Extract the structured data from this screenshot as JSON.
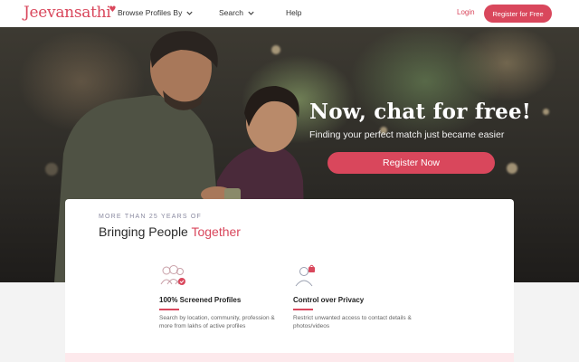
{
  "header": {
    "logo": "Jeevansathi",
    "nav": [
      {
        "label": "Browse Profiles By",
        "has_dropdown": true
      },
      {
        "label": "Search",
        "has_dropdown": true
      },
      {
        "label": "Help",
        "has_dropdown": false
      }
    ],
    "login_label": "Login",
    "register_label": "Register for Free"
  },
  "hero": {
    "title": "Now, chat for free!",
    "subtitle": "Finding your perfect match just became easier",
    "cta_label": "Register Now"
  },
  "card": {
    "eyebrow": "MORE THAN 25 YEARS OF",
    "title_main": "Bringing People ",
    "title_accent": "Together",
    "features": [
      {
        "icon": "people-check-icon",
        "title": "100% Screened Profiles",
        "text": "Search by location, community, profession & more from lakhs of active profiles"
      },
      {
        "icon": "privacy-lock-icon",
        "title": "Control over Privacy",
        "text": "Restrict unwanted access to contact details & photos/videos"
      }
    ]
  },
  "colors": {
    "brand": "#d9475c",
    "header_bg": "#ffffff"
  }
}
